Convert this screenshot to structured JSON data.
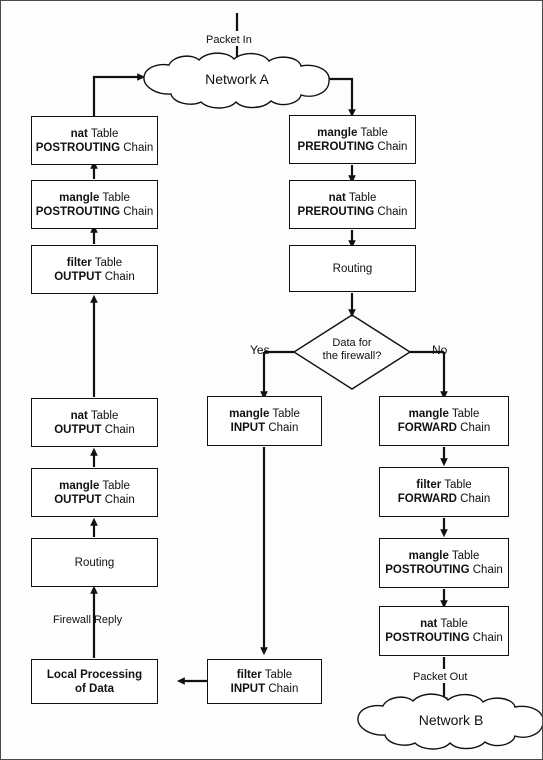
{
  "diagram": {
    "title": "iptables packet flow",
    "background": "#fdfdfd",
    "border_color": "#4a4a4a",
    "line_color": "#111111"
  },
  "clouds": [
    {
      "id": "network-a",
      "label": "Network A"
    },
    {
      "id": "network-b",
      "label": "Network B"
    }
  ],
  "labels": {
    "packet_in": "Packet In",
    "packet_out": "Packet Out",
    "firewall_reply": "Firewall Reply",
    "yes": "Yes",
    "no": "No"
  },
  "decision": {
    "line1": "Data for",
    "line2": "the firewall?"
  },
  "nodes": {
    "nat_postrouting_left": {
      "table": "nat",
      "table_suffix": " Table",
      "chain": "POSTROUTING",
      "chain_suffix": " Chain"
    },
    "mangle_postrouting_left": {
      "table": "mangle",
      "table_suffix": " Table",
      "chain": "POSTROUTING",
      "chain_suffix": " Chain"
    },
    "filter_output_left": {
      "table": "filter",
      "table_suffix": " Table",
      "chain": "OUTPUT",
      "chain_suffix": " Chain"
    },
    "nat_output_left": {
      "table": "nat",
      "table_suffix": " Table",
      "chain": "OUTPUT",
      "chain_suffix": " Chain"
    },
    "mangle_output_left": {
      "table": "mangle",
      "table_suffix": " Table",
      "chain": "OUTPUT",
      "chain_suffix": " Chain"
    },
    "routing_left": {
      "text": "Routing"
    },
    "local_processing": {
      "line1": "Local Processing",
      "line2": "of Data"
    },
    "mangle_prerouting": {
      "table": "mangle",
      "table_suffix": " Table",
      "chain": "PREROUTING",
      "chain_suffix": " Chain"
    },
    "nat_prerouting": {
      "table": "nat",
      "table_suffix": " Table",
      "chain": "PREROUTING",
      "chain_suffix": " Chain"
    },
    "routing_right": {
      "text": "Routing"
    },
    "mangle_input": {
      "table": "mangle",
      "table_suffix": " Table",
      "chain": "INPUT",
      "chain_suffix": " Chain"
    },
    "filter_input": {
      "table": "filter",
      "table_suffix": " Table",
      "chain": "INPUT",
      "chain_suffix": " Chain"
    },
    "mangle_forward": {
      "table": "mangle",
      "table_suffix": " Table",
      "chain": "FORWARD",
      "chain_suffix": " Chain"
    },
    "filter_forward": {
      "table": "filter",
      "table_suffix": " Table",
      "chain": "FORWARD",
      "chain_suffix": " Chain"
    },
    "mangle_postrouting_right": {
      "table": "mangle",
      "table_suffix": " Table",
      "chain": "POSTROUTING",
      "chain_suffix": " Chain"
    },
    "nat_postrouting_right": {
      "table": "nat",
      "table_suffix": " Table",
      "chain": "POSTROUTING",
      "chain_suffix": " Chain"
    }
  }
}
